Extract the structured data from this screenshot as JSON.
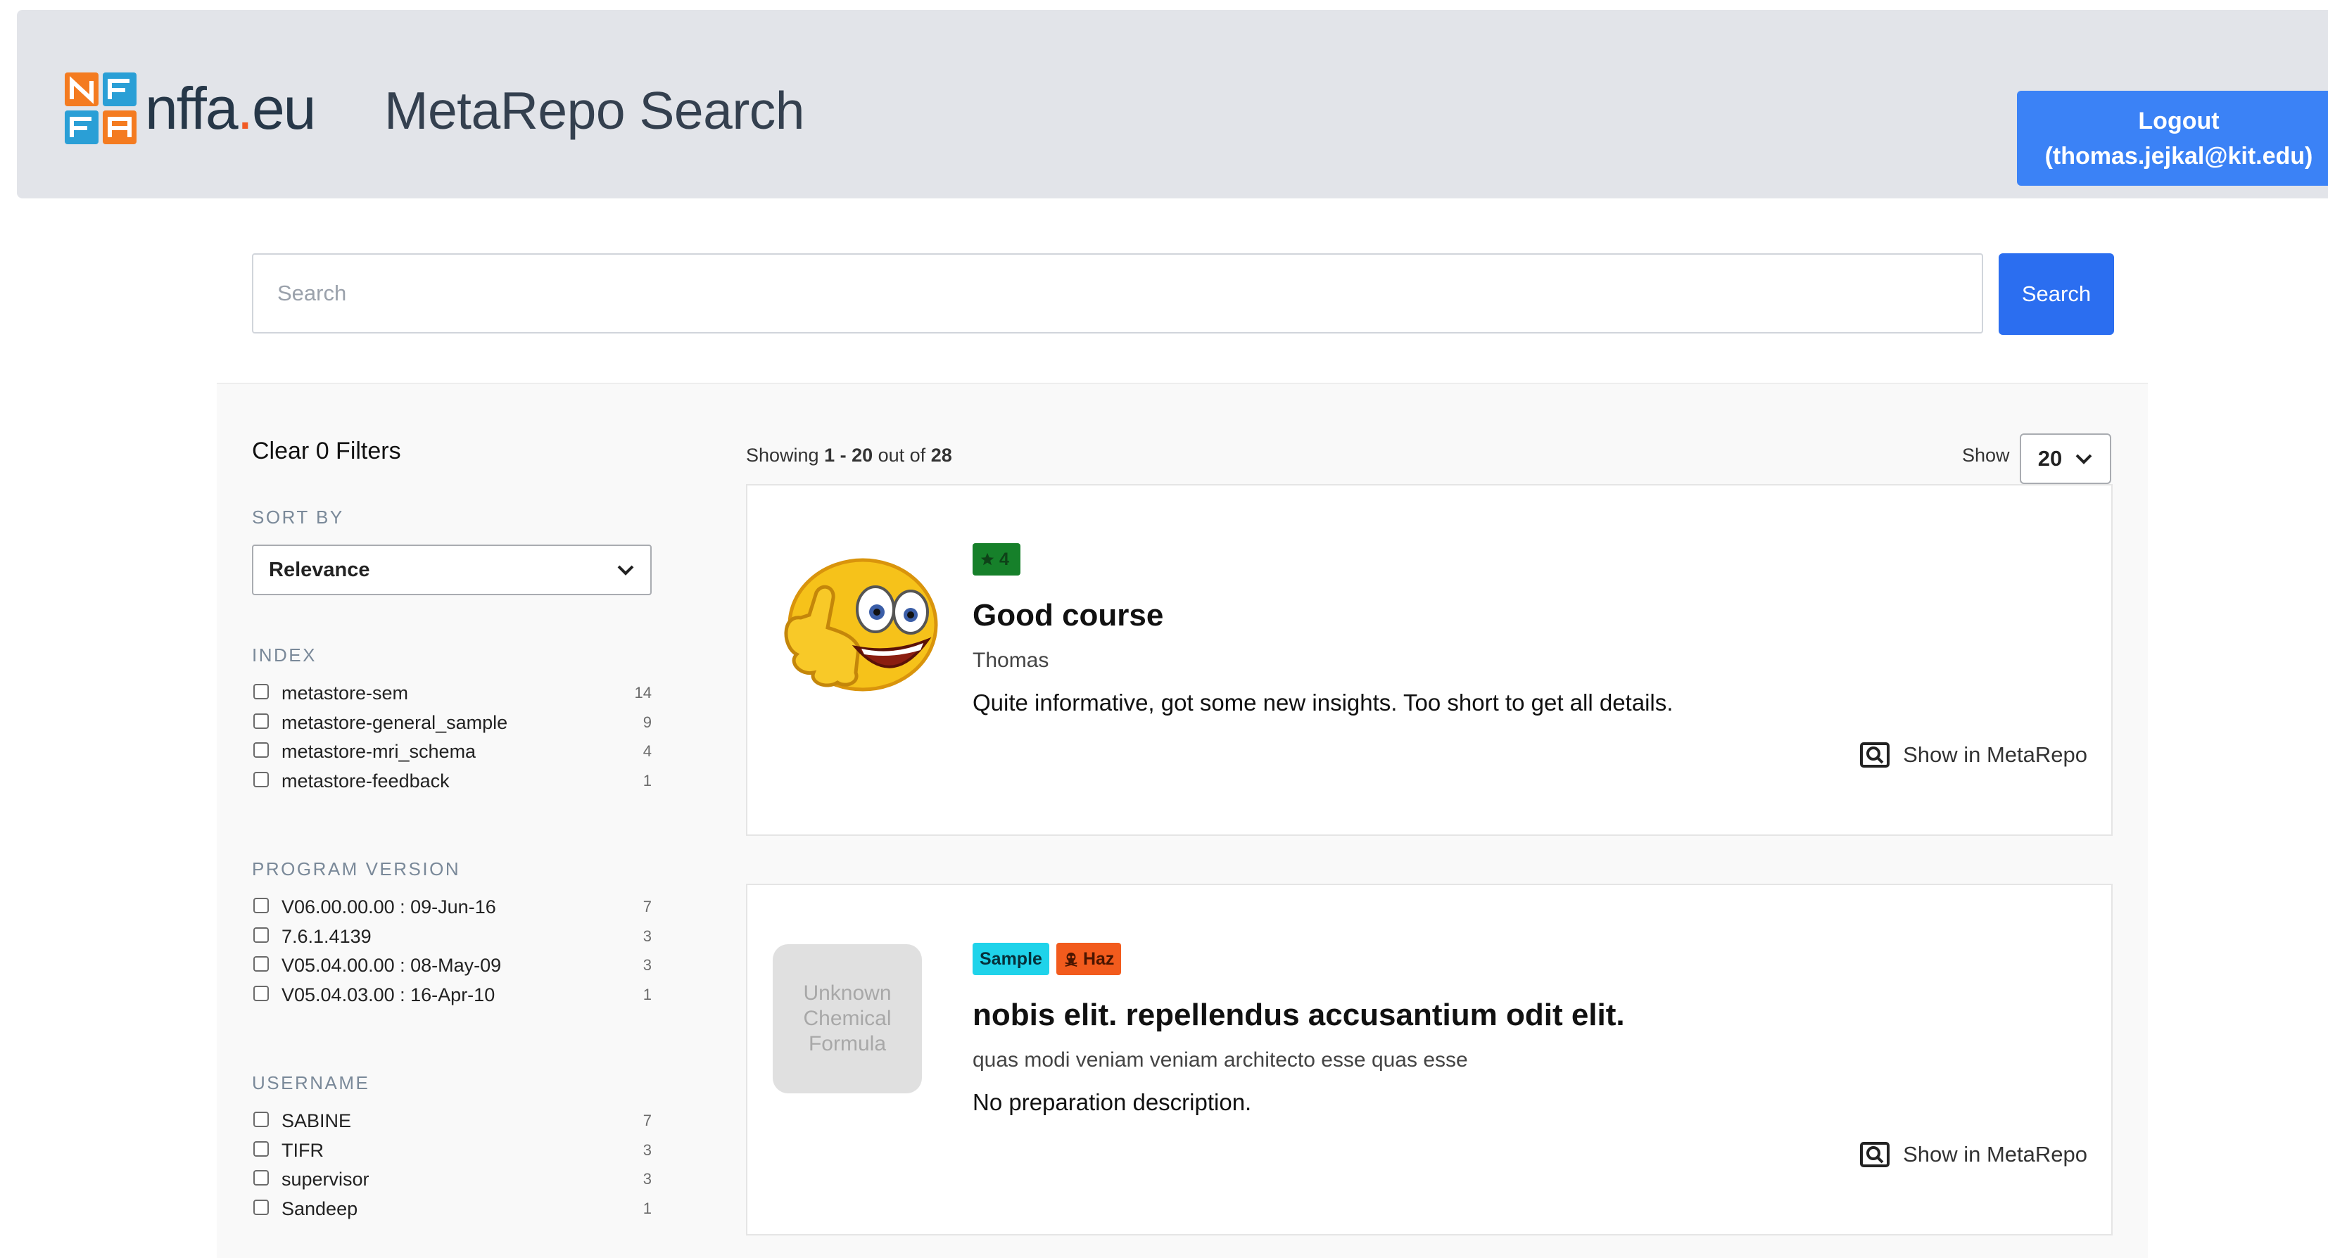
{
  "header": {
    "logo_text": "nffa",
    "logo_dot": ".",
    "logo_tld": "eu",
    "title": "MetaRepo Search",
    "logout_line1": "Logout",
    "logout_line2": "(thomas.jejkal@kit.edu)"
  },
  "search": {
    "placeholder": "Search",
    "button_label": "Search"
  },
  "sidebar": {
    "clear_filters": "Clear 0 Filters",
    "sort_by": {
      "title": "SORT BY",
      "selected": "Relevance"
    },
    "facets": [
      {
        "title": "INDEX",
        "items": [
          {
            "label": "metastore-sem",
            "count": "14"
          },
          {
            "label": "metastore-general_sample",
            "count": "9"
          },
          {
            "label": "metastore-mri_schema",
            "count": "4"
          },
          {
            "label": "metastore-feedback",
            "count": "1"
          }
        ]
      },
      {
        "title": "PROGRAM VERSION",
        "items": [
          {
            "label": "V06.00.00.00 : 09-Jun-16",
            "count": "7"
          },
          {
            "label": "7.6.1.4139",
            "count": "3"
          },
          {
            "label": "V05.04.00.00 : 08-May-09",
            "count": "3"
          },
          {
            "label": "V05.04.03.00 : 16-Apr-10",
            "count": "1"
          }
        ]
      },
      {
        "title": "USERNAME",
        "items": [
          {
            "label": "SABINE",
            "count": "7"
          },
          {
            "label": "TIFR",
            "count": "3"
          },
          {
            "label": "supervisor",
            "count": "3"
          },
          {
            "label": "Sandeep",
            "count": "1"
          }
        ]
      }
    ]
  },
  "results_summary": {
    "prefix": "Showing ",
    "range": "1 - 20",
    "middle": " out of ",
    "total": "28"
  },
  "page_size": {
    "label": "Show",
    "value": "20"
  },
  "results": [
    {
      "thumbnail": "thumbs-up-smiley",
      "badges": [
        {
          "type": "rating",
          "icon": "star-icon",
          "text": "4"
        }
      ],
      "title": "Good course",
      "subtitle": "Thomas",
      "description": "Quite informative, got some new insights. Too short to get all details.",
      "link_label": "Show in MetaRepo"
    },
    {
      "thumbnail_text": "Unknown Chemical Formula",
      "badges": [
        {
          "type": "sample",
          "text": "Sample"
        },
        {
          "type": "haz",
          "icon": "skull-icon",
          "text": "Haz"
        }
      ],
      "title": "nobis elit. repellendus accusantium odit elit.",
      "subtitle": "quas modi veniam veniam architecto esse quas esse",
      "description": "No preparation description.",
      "link_label": "Show in MetaRepo"
    }
  ],
  "colors": {
    "header_bg": "#e2e4e9",
    "primary_button": "#3b82f6",
    "search_button": "#2b6ef0",
    "rating_badge": "#16802a",
    "sample_badge": "#1fd3ea",
    "haz_badge": "#f25b1d",
    "logo_accent": "#f15a24"
  }
}
